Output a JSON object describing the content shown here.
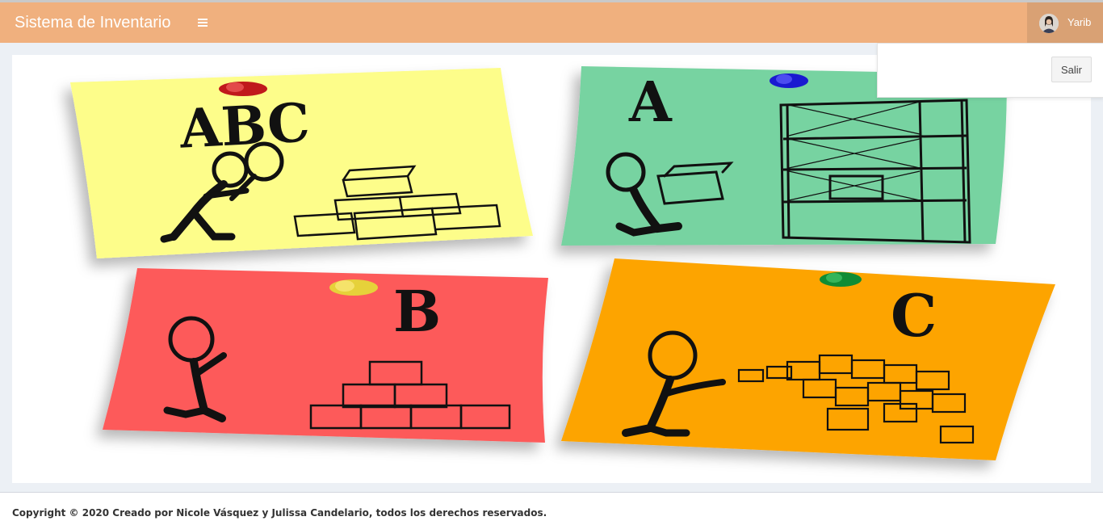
{
  "header": {
    "brand": "Sistema de Inventario",
    "menu_icon": "hamburger-icon",
    "user": {
      "name": "Yarib",
      "avatar_icon": "user-avatar"
    }
  },
  "user_dropdown": {
    "logout_label": "Salir"
  },
  "main": {
    "image": "inventory-illustration",
    "notes": [
      {
        "letters": "ABC",
        "color": "#fdfd8a",
        "pin_color": "#c0191c"
      },
      {
        "letters": "A",
        "color": "#77d3a1",
        "pin_color": "#1a1ad0"
      },
      {
        "letters": "B",
        "color": "#fd5a5a",
        "pin_color": "#e6d13a"
      },
      {
        "letters": "C",
        "color": "#fda400",
        "pin_color": "#0f8c34"
      }
    ]
  },
  "footer": {
    "copyright": "Copyright © 2020 Creado por Nicole Vásquez y Julissa Candelario, todos los derechos reservados."
  }
}
